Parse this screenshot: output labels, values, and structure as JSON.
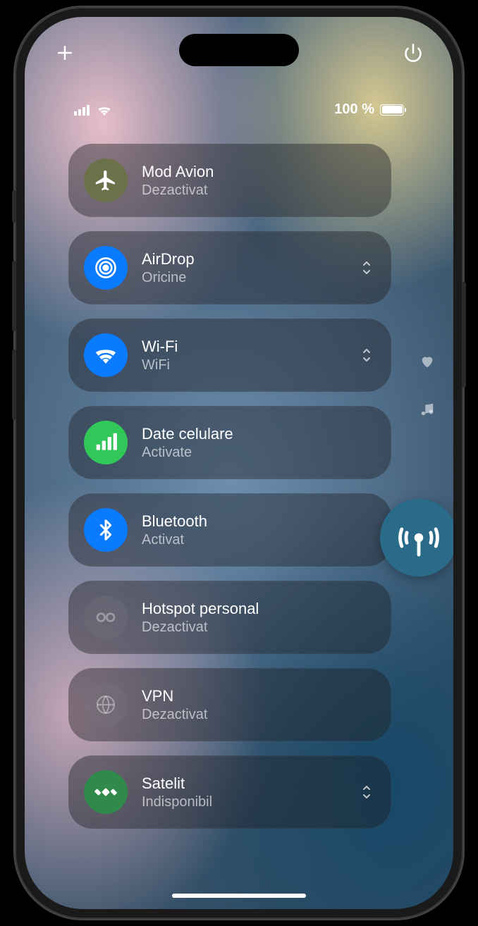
{
  "status": {
    "battery_text": "100 %"
  },
  "controls": [
    {
      "id": "airplane",
      "title": "Mod Avion",
      "subtitle": "Dezactivat",
      "expandable": false,
      "icon": "airplane-icon",
      "color": "ic-olive"
    },
    {
      "id": "airdrop",
      "title": "AirDrop",
      "subtitle": "Oricine",
      "expandable": true,
      "icon": "airdrop-icon",
      "color": "ic-blue"
    },
    {
      "id": "wifi",
      "title": "Wi-Fi",
      "subtitle": "WiFi",
      "expandable": true,
      "icon": "wifi-icon",
      "color": "ic-blue"
    },
    {
      "id": "cellular",
      "title": "Date celulare",
      "subtitle": "Activate",
      "expandable": false,
      "icon": "cellular-icon",
      "color": "ic-green"
    },
    {
      "id": "bluetooth",
      "title": "Bluetooth",
      "subtitle": "Activat",
      "expandable": false,
      "icon": "bluetooth-icon",
      "color": "ic-blue"
    },
    {
      "id": "hotspot",
      "title": "Hotspot personal",
      "subtitle": "Dezactivat",
      "expandable": false,
      "icon": "hotspot-icon",
      "color": "ic-dim"
    },
    {
      "id": "vpn",
      "title": "VPN",
      "subtitle": "Dezactivat",
      "expandable": false,
      "icon": "vpn-icon",
      "color": "ic-dim"
    },
    {
      "id": "satellite",
      "title": "Satelit",
      "subtitle": "Indisponibil",
      "expandable": true,
      "icon": "satellite-icon",
      "color": "ic-dgreen"
    }
  ]
}
